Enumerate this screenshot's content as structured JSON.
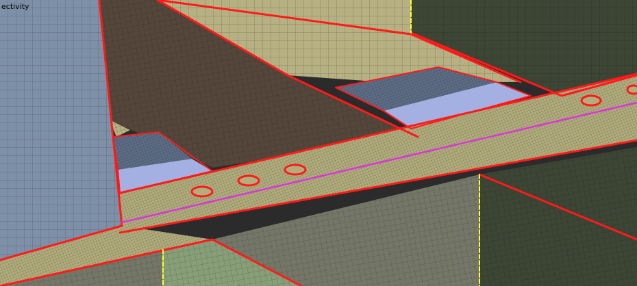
{
  "viewport": {
    "overlay_label": "ectivity",
    "colors": {
      "mesh_line": "#141414",
      "free_edge": "#ff1a1a",
      "t_connection": "#ffff33",
      "weld_line": "#dd33dd",
      "panel_slate": "#7d90a7",
      "panel_tan": "#b6b082",
      "panel_brown": "#54463a",
      "panel_olive": "#3d4535",
      "panel_gray": "#747768",
      "flange_tan": "#b2ad7d",
      "panel_green": "#889e78",
      "panel_blue_mesh": "#5d6d86",
      "cutout_light": "#a4b0e2"
    }
  }
}
